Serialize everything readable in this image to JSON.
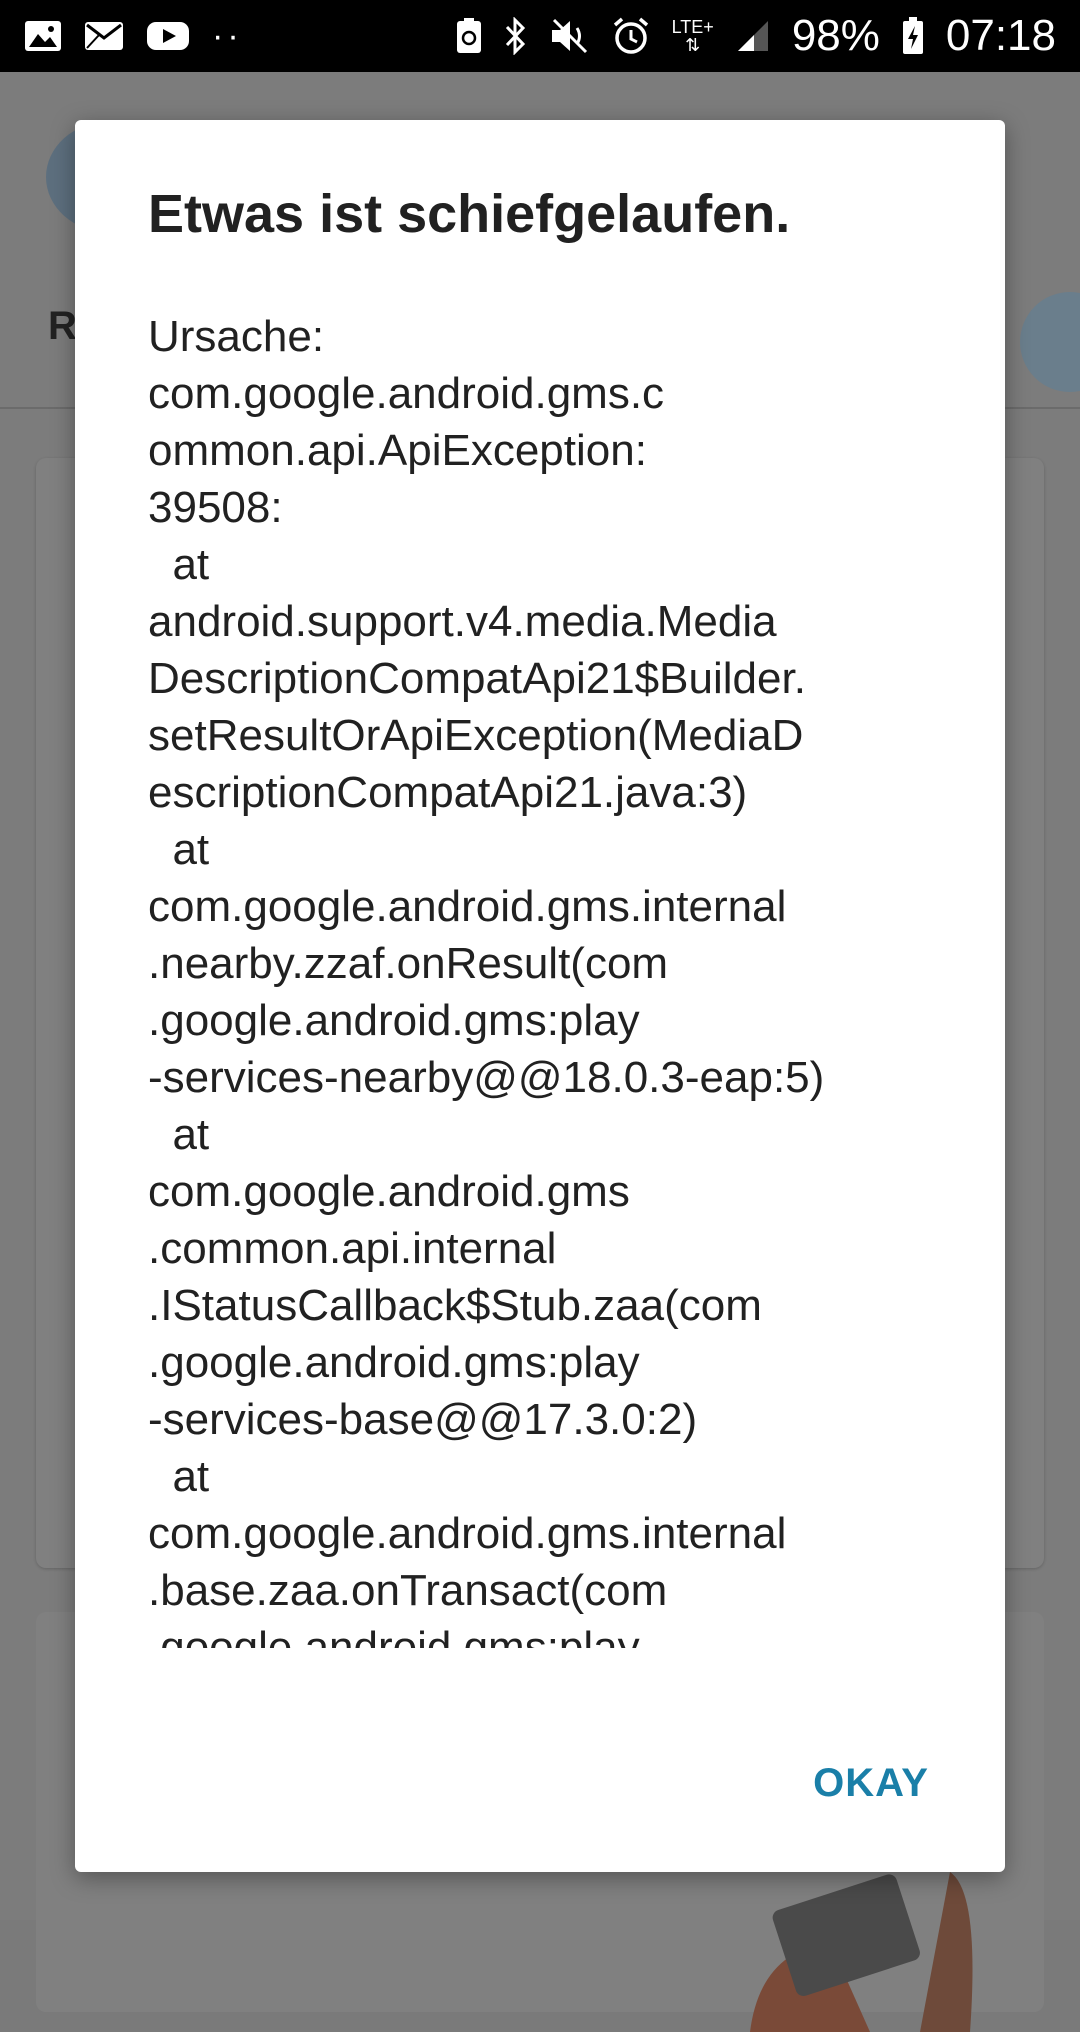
{
  "status_bar": {
    "left_icons": [
      "image-icon",
      "mail-icon",
      "youtube-icon"
    ],
    "overflow": "··",
    "right_icons": [
      "nfc-icon",
      "bluetooth-icon",
      "mute-icon",
      "alarm-icon"
    ],
    "network": "LTE+",
    "battery": "98%",
    "time": "07:18"
  },
  "background": {
    "heading_initial": "R"
  },
  "dialog": {
    "title": "Etwas ist schiefgelaufen.",
    "message": "Ursache:\ncom.google.android.gms.c\nommon.api.ApiException:\n39508:\n  at\nandroid.support.v4.media.Media\nDescriptionCompatApi21$Builder.\nsetResultOrApiException(MediaD\nescriptionCompatApi21.java:3)\n  at\ncom.google.android.gms.internal\n.nearby.zzaf.onResult(com\n.google.android.gms:play\n-services-nearby@@18.0.3-eap:5)\n  at\ncom.google.android.gms\n.common.api.internal\n.IStatusCallback$Stub.zaa(com\n.google.android.gms:play\n-services-base@@17.3.0:2)\n  at\ncom.google.android.gms.internal\n.base.zaa.onTransact(com\n.google.android.gms:play",
    "ok_label": "OKAY"
  },
  "colors": {
    "accent": "#1a7fa8",
    "scrim": "#7a7a7a",
    "status_bar": "#000000"
  }
}
